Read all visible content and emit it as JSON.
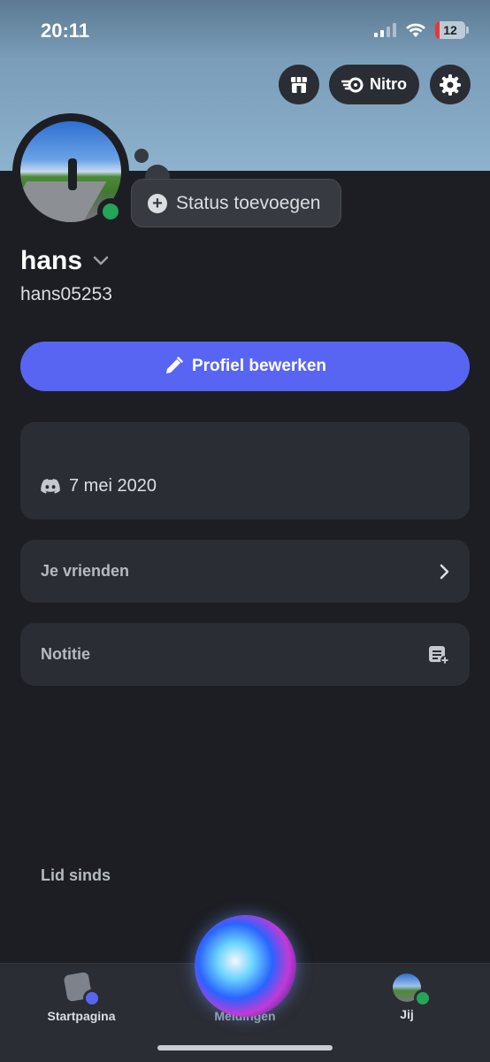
{
  "status_bar": {
    "time": "20:11",
    "battery": "12"
  },
  "header": {
    "nitro_label": "Nitro"
  },
  "profile": {
    "status_placeholder": "Status toevoegen",
    "display_name": "hans",
    "username": "hans05253",
    "edit_button_label": "Profiel bewerken"
  },
  "member_since": {
    "label": "Lid sinds",
    "date": "7 mei 2020"
  },
  "friends": {
    "label": "Je vrienden"
  },
  "note": {
    "label": "Notitie"
  },
  "tabs": [
    {
      "label": "Startpagina"
    },
    {
      "label": "Meldingen"
    },
    {
      "label": "Jij"
    }
  ],
  "colors": {
    "accent": "#5865f2",
    "online": "#23a55a",
    "background": "#1d1e23",
    "card": "#2b2d34"
  }
}
